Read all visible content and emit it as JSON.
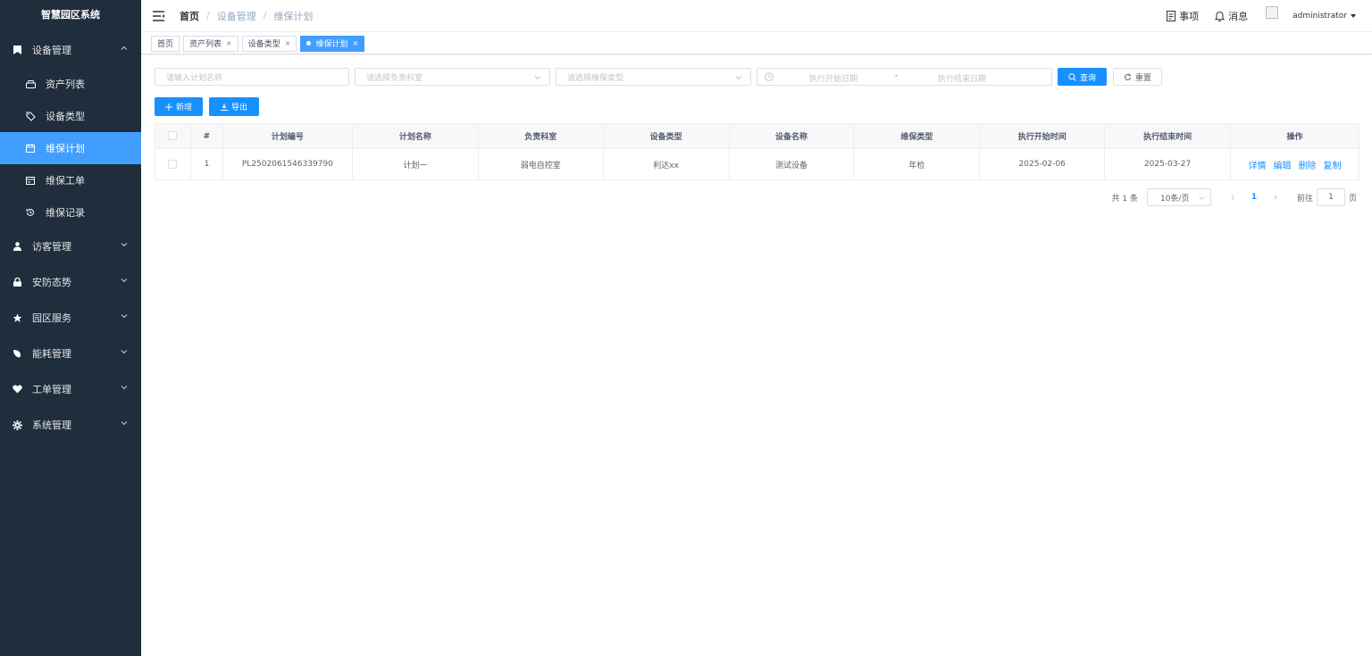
{
  "sidebar": {
    "brand": "智慧园区系统",
    "groups": [
      {
        "label": "设备管理",
        "icon": "bookmark-icon",
        "expanded": true,
        "items": [
          {
            "label": "资产列表",
            "icon": "hdd-icon"
          },
          {
            "label": "设备类型",
            "icon": "tag-icon"
          },
          {
            "label": "维保计划",
            "icon": "calendar-icon",
            "active": true
          },
          {
            "label": "维保工单",
            "icon": "card-icon"
          },
          {
            "label": "维保记录",
            "icon": "history-icon"
          }
        ]
      },
      {
        "label": "访客管理",
        "icon": "user-icon"
      },
      {
        "label": "安防态势",
        "icon": "lock-icon"
      },
      {
        "label": "园区服务",
        "icon": "star-icon"
      },
      {
        "label": "能耗管理",
        "icon": "leaf-icon"
      },
      {
        "label": "工单管理",
        "icon": "heart-icon"
      },
      {
        "label": "系统管理",
        "icon": "gear-icon"
      }
    ]
  },
  "navbar": {
    "breadcrumb": [
      "首页",
      "设备管理",
      "维保计划"
    ],
    "todo_label": "事项",
    "message_label": "消息",
    "username": "administrator"
  },
  "tags": [
    {
      "label": "首页",
      "closable": false
    },
    {
      "label": "资产列表",
      "closable": true
    },
    {
      "label": "设备类型",
      "closable": true
    },
    {
      "label": "维保计划",
      "closable": true,
      "active": true
    }
  ],
  "filters": {
    "plan_name_placeholder": "请输入计划名称",
    "department_placeholder": "请选择负责科室",
    "maintenance_type_placeholder": "请选择维保类型",
    "start_date_placeholder": "执行开始日期",
    "range_separator": "-",
    "end_date_placeholder": "执行结束日期",
    "search_label": "查询",
    "reset_label": "重置"
  },
  "actions": {
    "add_label": "新增",
    "export_label": "导出"
  },
  "table": {
    "columns": [
      "#",
      "计划编号",
      "计划名称",
      "负责科室",
      "设备类型",
      "设备名称",
      "维保类型",
      "执行开始时间",
      "执行结束时间",
      "操作"
    ],
    "rows": [
      {
        "index": "1",
        "code": "PL2502061546339790",
        "name": "计划一",
        "department": "弱电自控室",
        "device_type": "利达xx",
        "device_name": "测试设备",
        "maintenance_type": "年检",
        "start": "2025-02-06",
        "end": "2025-03-27"
      }
    ],
    "row_actions": [
      "详情",
      "编辑",
      "删除",
      "复制"
    ]
  },
  "pagination": {
    "total_text": "共 1 条",
    "page_size": "10条/页",
    "current_page": "1",
    "goto_prefix": "前往",
    "goto_value": "1",
    "goto_suffix": "页"
  },
  "colors": {
    "sidebar_bg": "#1f2d3d",
    "accent": "#409eff",
    "primary_button": "#1890ff"
  }
}
